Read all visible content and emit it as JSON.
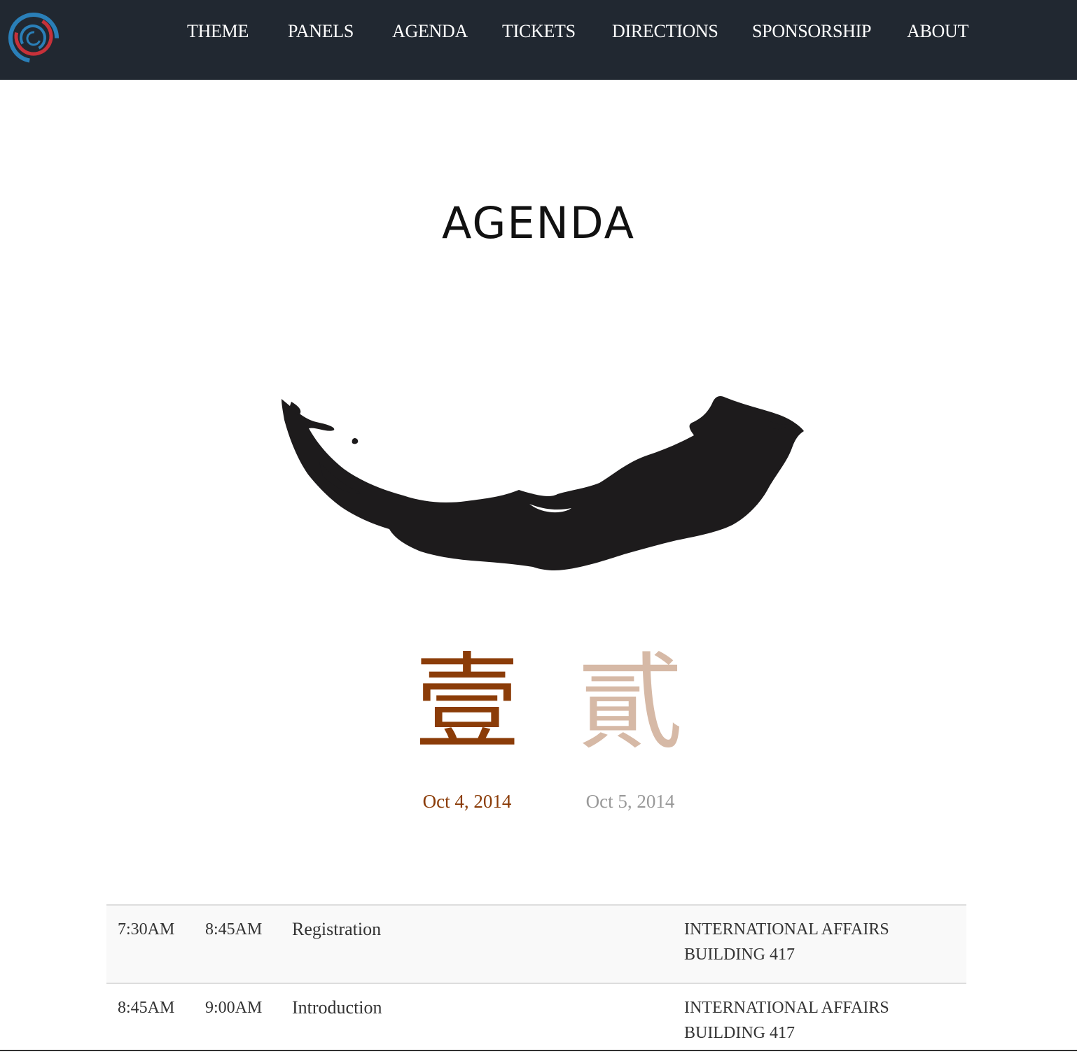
{
  "nav": {
    "logo_icon": "swirl-logo-icon",
    "links": [
      {
        "label": "THEME"
      },
      {
        "label": "PANELS"
      },
      {
        "label": "AGENDA"
      },
      {
        "label": "TICKETS"
      },
      {
        "label": "DIRECTIONS"
      },
      {
        "label": "SPONSORSHIP"
      },
      {
        "label": "ABOUT"
      }
    ],
    "background_color": "#212831",
    "logo_colors": [
      "#2a7fb8",
      "#c7313a"
    ]
  },
  "page": {
    "title": "AGENDA",
    "decoration_icon": "ink-brush-stroke-icon"
  },
  "days": [
    {
      "glyph": "壹",
      "date": "Oct 4, 2014",
      "active": true
    },
    {
      "glyph": "貳",
      "date": "Oct 5, 2014",
      "active": false
    }
  ],
  "colors": {
    "active_day": "#8b3c08",
    "inactive_day_glyph": "#d6b9a6",
    "inactive_day_date": "#999999"
  },
  "agenda": {
    "rows": [
      {
        "start": "7:30AM",
        "end": "8:45AM",
        "title": "Registration",
        "location": "INTERNATIONAL AFFAIRS BUILDING 417"
      },
      {
        "start": "8:45AM",
        "end": "9:00AM",
        "title": "Introduction",
        "location": "INTERNATIONAL AFFAIRS BUILDING 417"
      }
    ]
  }
}
